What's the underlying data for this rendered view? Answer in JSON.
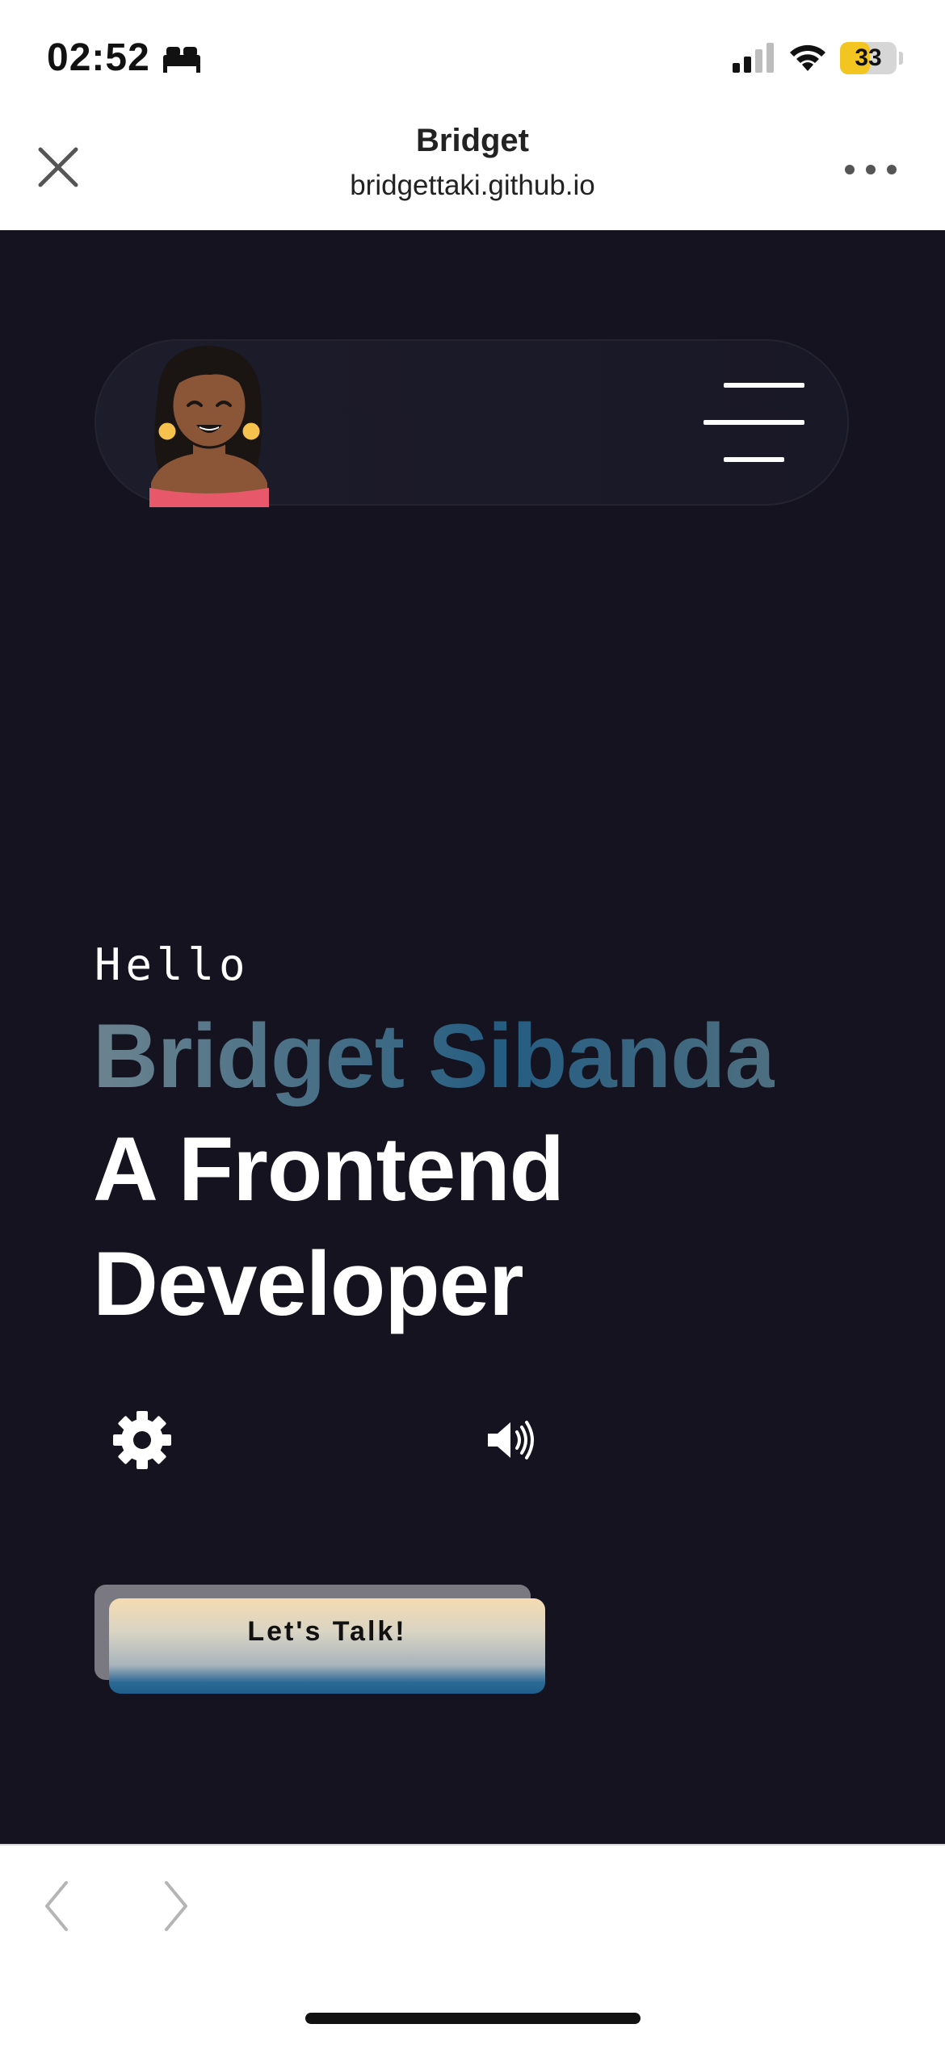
{
  "status_bar": {
    "time": "02:52",
    "sleep_icon": "bed-icon",
    "signal_icon": "cellular-signal-icon",
    "wifi_icon": "wifi-icon",
    "battery_level": "33",
    "battery_percent": 33,
    "battery_color": "#f3c520"
  },
  "browser": {
    "close_icon": "close-icon",
    "title": "Bridget",
    "url": "bridgettaki.github.io",
    "more_icon": "more-icon"
  },
  "site": {
    "background": "#14131f",
    "nav": {
      "avatar": "avatar-illustration",
      "menu_icon": "hamburger-menu-icon"
    },
    "hero": {
      "greeting": "Hello",
      "name": "Bridget Sibanda",
      "role_line_1": "A Frontend",
      "role_line_2": "Developer"
    },
    "controls": {
      "settings_icon": "gear-icon",
      "sound_icon": "speaker-icon"
    },
    "cta_label": "Let's Talk!"
  },
  "bottom_bar": {
    "back_icon": "chevron-left-icon",
    "forward_icon": "chevron-right-icon"
  }
}
